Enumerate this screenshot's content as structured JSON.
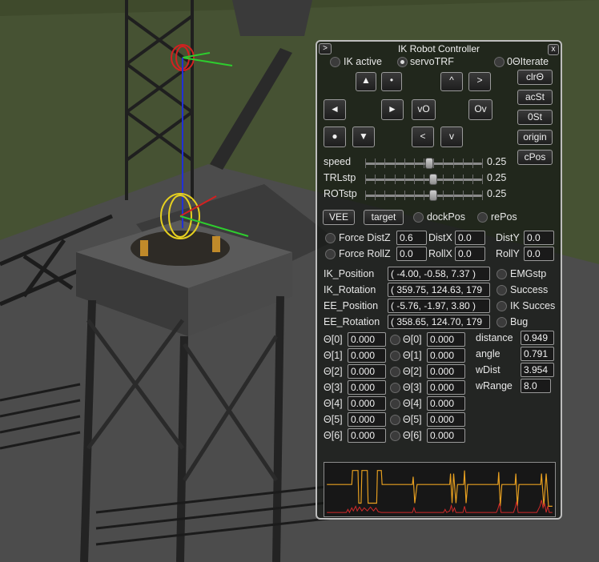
{
  "panel": {
    "title": "IK Robot Controller",
    "expand_label": ">",
    "close_label": "x",
    "top_toggles": [
      {
        "label": "IK active",
        "checked": false
      },
      {
        "label": "servoTRF",
        "checked": true
      },
      {
        "label": "0ΘIterate",
        "checked": false
      }
    ],
    "dir_buttons": {
      "up_arrow": "▲",
      "dot_small": "•",
      "left_arrow": "◄",
      "right_arrow": "►",
      "dot_big": "●",
      "down_arrow": "▼",
      "caret_up": "^",
      "chevron_right": ">",
      "vo": "vO",
      "ov": "Ov",
      "chevron_left": "<",
      "caret_down": "v"
    },
    "side_buttons": [
      "clrΘ",
      "acSt",
      "0St",
      "origin",
      "cPos"
    ],
    "sliders": [
      {
        "label": "speed",
        "value": "0.25",
        "position": 0.55
      },
      {
        "label": "TRLstp",
        "value": "0.25",
        "position": 0.58
      },
      {
        "label": "ROTstp",
        "value": "0.25",
        "position": 0.58
      }
    ],
    "mode_buttons": {
      "vee": "VEE",
      "target": "target"
    },
    "mode_toggles": [
      {
        "label": "dockPos",
        "checked": false
      },
      {
        "label": "rePos",
        "checked": false
      }
    ],
    "force_dist": {
      "label": "Force DistZ",
      "z": "0.6",
      "x_label": "DistX",
      "x": "0.0",
      "y_label": "DistY",
      "y": "0.0"
    },
    "force_roll": {
      "label": "Force RollZ",
      "z": "0.0",
      "x_label": "RollX",
      "x": "0.0",
      "y_label": "RollY",
      "y": "0.0"
    },
    "readouts": [
      {
        "label": "IK_Position",
        "value": "( -4.00, -0.58, 7.37 )",
        "flag": "EMGstp"
      },
      {
        "label": "IK_Rotation",
        "value": "( 359.75, 124.63, 179",
        "flag": "Success"
      },
      {
        "label": "EE_Position",
        "value": "( -5.76, -1.97, 3.80 )",
        "flag": "IK Succes"
      },
      {
        "label": "EE_Rotation",
        "value": "( 358.65, 124.70, 179",
        "flag": "Bug"
      }
    ],
    "theta_rows": [
      {
        "label": "Θ[0]",
        "a": "0.000",
        "b": "0.000"
      },
      {
        "label": "Θ[1]",
        "a": "0.000",
        "b": "0.000"
      },
      {
        "label": "Θ[2]",
        "a": "0.000",
        "b": "0.000"
      },
      {
        "label": "Θ[3]",
        "a": "0.000",
        "b": "0.000"
      },
      {
        "label": "Θ[4]",
        "a": "0.000",
        "b": "0.000"
      },
      {
        "label": "Θ[5]",
        "a": "0.000",
        "b": "0.000"
      },
      {
        "label": "Θ[6]",
        "a": "0.000",
        "b": "0.000"
      }
    ],
    "stats": [
      {
        "label": "distance",
        "value": "0.949"
      },
      {
        "label": "angle",
        "value": "0.791"
      },
      {
        "label": "wDist",
        "value": "3.954"
      },
      {
        "label": "wRange",
        "value": "8.0"
      }
    ],
    "graph_colors": {
      "yellow": "#e8a020",
      "red": "#d22a2a"
    }
  }
}
